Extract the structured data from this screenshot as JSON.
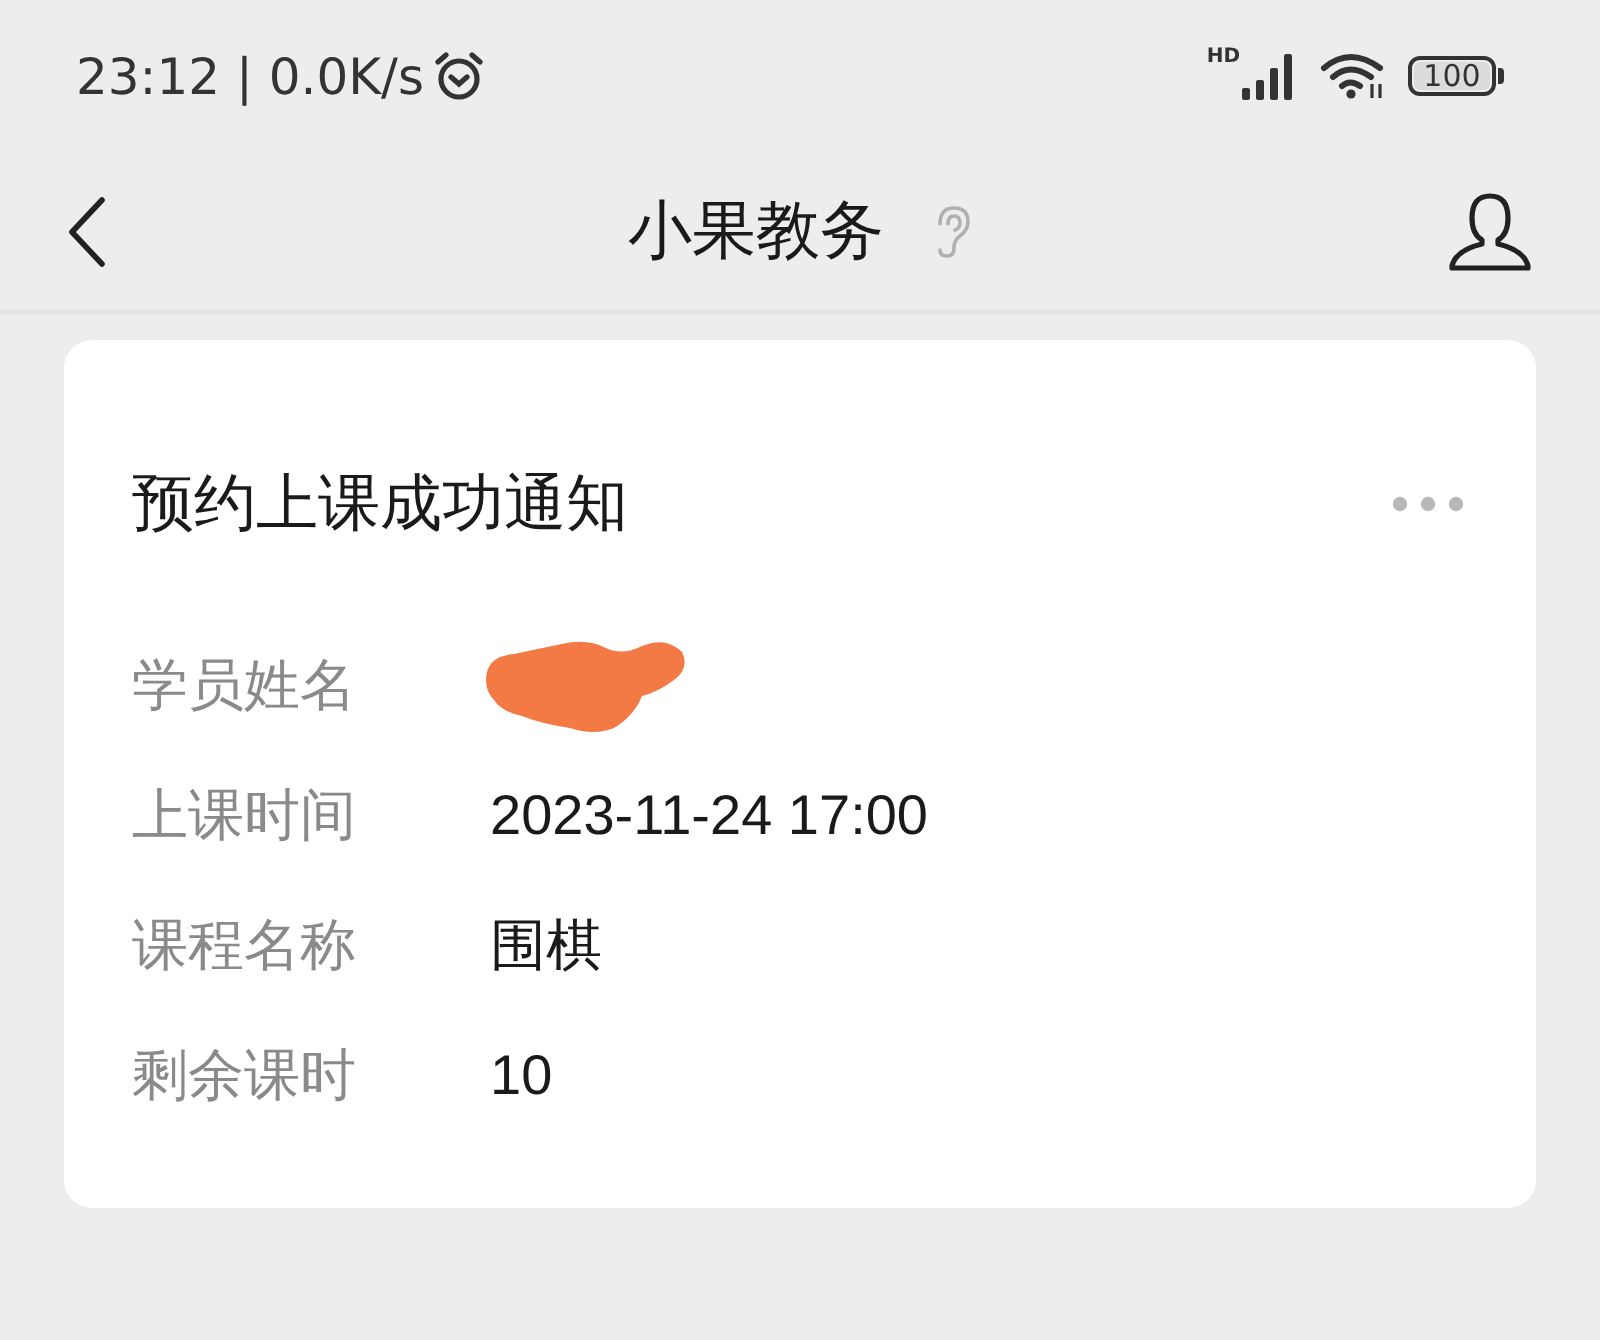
{
  "status_bar": {
    "time_speed": "23:12 | 0.0K/s",
    "network_type": "HD",
    "battery": "100"
  },
  "nav_bar": {
    "title": "小果教务"
  },
  "card": {
    "title": "预约上课成功通知",
    "rows": [
      {
        "label": "学员姓名",
        "redacted": true
      },
      {
        "label": "上课时间",
        "value": "2023-11-24 17:00",
        "redacted": false
      },
      {
        "label": "课程名称",
        "value": "围棋",
        "redacted": false
      },
      {
        "label": "剩余课时",
        "value": "10",
        "redacted": false
      }
    ]
  }
}
